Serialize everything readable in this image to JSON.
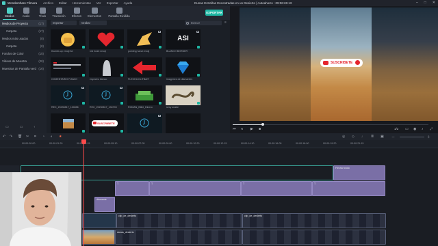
{
  "window": {
    "app_name": "Wondershare Filmora",
    "menu": [
      "Archivo",
      "Editar",
      "Herramientas",
      "Ver",
      "Exportar",
      "Ayuda"
    ],
    "doc_title": "Dunas Extrañas Encontradas en un Desierto",
    "autosave": "Autoahorro : 09:06:26:13"
  },
  "toolbar": {
    "tools": [
      {
        "label": "Medios",
        "icon": "media-icon",
        "color": "#4dd0c6"
      },
      {
        "label": "Audio",
        "icon": "audio-icon",
        "color": "#7d8593"
      },
      {
        "label": "Título",
        "icon": "title-icon",
        "color": "#7d8593"
      },
      {
        "label": "Transición",
        "icon": "transition-icon",
        "color": "#7d8593"
      },
      {
        "label": "Efectos",
        "icon": "effects-icon",
        "color": "#7d8593"
      },
      {
        "label": "Elementos",
        "icon": "elements-icon",
        "color": "#7d8593"
      },
      {
        "label": "Pantalla Dividida",
        "icon": "split-screen-icon",
        "color": "#7d8593"
      }
    ],
    "export_label": "EXPORTAR"
  },
  "sidebar": {
    "items": [
      {
        "label": "Medios de Proyecto",
        "count": "(17)"
      },
      {
        "label": "Carpeta",
        "count": "(17)"
      },
      {
        "label": "Medios más usados",
        "count": "(0)"
      },
      {
        "label": "Carpeta",
        "count": "(0)"
      },
      {
        "label": "Fondos de Color",
        "count": "(15)"
      },
      {
        "label": "Vídeos de Muestra",
        "count": "(20)"
      },
      {
        "label": "Muestras de Pantalla verd",
        "count": "(16)"
      }
    ]
  },
  "media": {
    "import_label": "Importar",
    "filter_label": "Grabar",
    "search_placeholder": "Buscar",
    "items": [
      {
        "caption": "thumbs up emoji 3d"
      },
      {
        "caption": "red heart emoji"
      },
      {
        "caption": "pointing hand emoji"
      },
      {
        "caption": "BLANCO BORDER",
        "title": "ASI"
      },
      {
        "caption": "COMENTARIO FIJADO"
      },
      {
        "caption": "espectro blanco"
      },
      {
        "caption": "FLECHA CLITBAIT"
      },
      {
        "caption": "imagenes de diamantes"
      },
      {
        "caption": "REC_20230817_134656"
      },
      {
        "caption": "REC_20230817_134703"
      },
      {
        "caption": "ROMAN_Billet_Dinero"
      },
      {
        "caption": "sexy snake"
      },
      {
        "caption": ""
      },
      {
        "caption": "",
        "badge": "SUSCRIBETE"
      },
      {
        "caption": ""
      },
      {
        "caption": ""
      }
    ]
  },
  "preview": {
    "subscribe_label": "SUSCRIBETE",
    "quality": "1/2"
  },
  "timeline": {
    "ruler": [
      "00:00:00:00",
      "00:00:01:20",
      "00:00:03:15",
      "00:00:05:10",
      "00:00:07:05",
      "00:00:09:00",
      "00:00:10:20",
      "00:00:12:15",
      "00:00:14:10",
      "00:00:16:05",
      "00:00:18:00",
      "00:00:19:20",
      "00:00:21:15"
    ],
    "clips": {
      "top_right": "Flecha fondo",
      "title_a": "T",
      "image_clip": "diamante",
      "video_a": "clip_de_desierto",
      "video_b": "clip_de_desierto",
      "video_c": "dunas_desierto"
    }
  }
}
